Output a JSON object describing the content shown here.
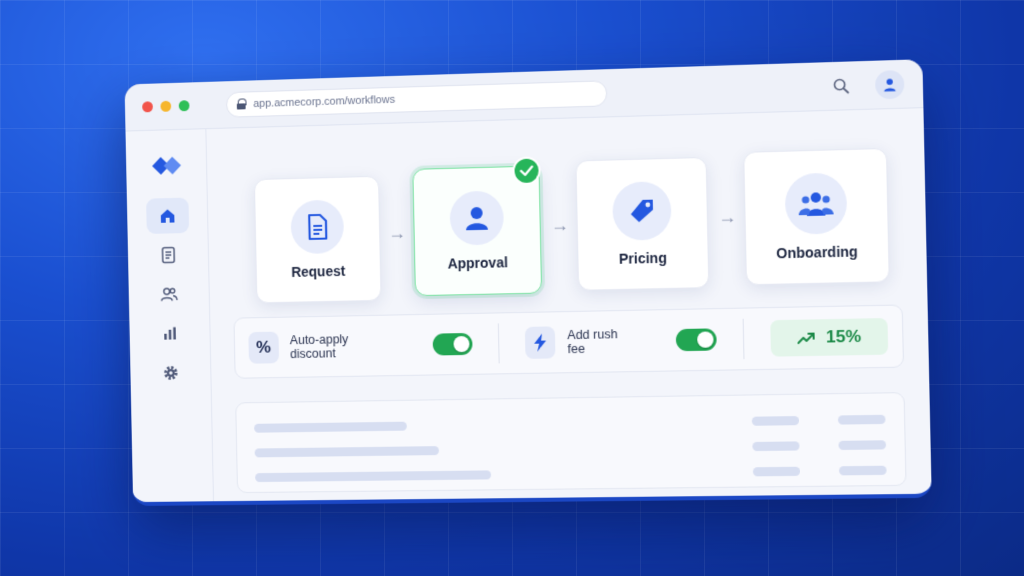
{
  "browser": {
    "url": "app.acmecorp.com/workflows"
  },
  "sidebar": {
    "items": [
      {
        "name": "home",
        "icon": "home-icon",
        "active": true
      },
      {
        "name": "documents",
        "icon": "document-icon",
        "active": false
      },
      {
        "name": "users",
        "icon": "users-icon",
        "active": false
      },
      {
        "name": "analytics",
        "icon": "bar-chart-icon",
        "active": false
      },
      {
        "name": "settings",
        "icon": "gear-icon",
        "active": false
      }
    ]
  },
  "workflow": {
    "steps": [
      {
        "label": "Request",
        "icon": "document-icon",
        "active": false
      },
      {
        "label": "Approval",
        "icon": "user-icon",
        "active": true
      },
      {
        "label": "Pricing",
        "icon": "tag-icon",
        "active": false
      },
      {
        "label": "Onboarding",
        "icon": "team-icon",
        "active": false
      }
    ]
  },
  "options": {
    "discount": {
      "label": "Auto-apply discount",
      "icon": "percent-icon",
      "icon_glyph": "%",
      "enabled": true
    },
    "rush": {
      "label": "Add rush fee",
      "icon": "lightning-icon",
      "enabled": true
    },
    "metric": {
      "value": "15%",
      "icon": "trend-up-icon"
    }
  },
  "colors": {
    "accent": "#2458e0",
    "success": "#22a653",
    "background": "#1a4fd0"
  }
}
